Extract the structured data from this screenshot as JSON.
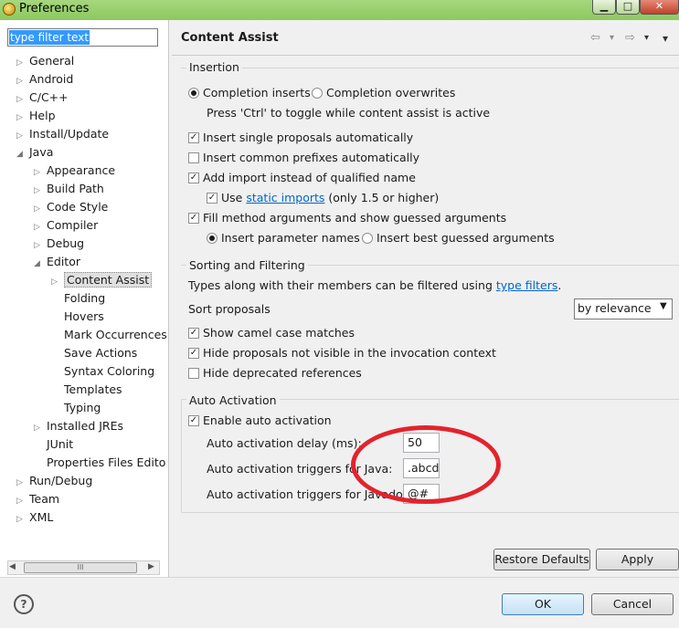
{
  "window": {
    "title": "Preferences",
    "min_glyph": "▁",
    "max_glyph": "□",
    "close_glyph": "✕"
  },
  "filter": {
    "value": "type filter text"
  },
  "tree": [
    {
      "label": "General",
      "arrow": "▷",
      "level": 0
    },
    {
      "label": "Android",
      "arrow": "▷",
      "level": 0
    },
    {
      "label": "C/C++",
      "arrow": "▷",
      "level": 0
    },
    {
      "label": "Help",
      "arrow": "▷",
      "level": 0
    },
    {
      "label": "Install/Update",
      "arrow": "▷",
      "level": 0
    },
    {
      "label": "Java",
      "arrow": "◢",
      "level": 0
    },
    {
      "label": "Appearance",
      "arrow": "▷",
      "level": 1
    },
    {
      "label": "Build Path",
      "arrow": "▷",
      "level": 1
    },
    {
      "label": "Code Style",
      "arrow": "▷",
      "level": 1
    },
    {
      "label": "Compiler",
      "arrow": "▷",
      "level": 1
    },
    {
      "label": "Debug",
      "arrow": "▷",
      "level": 1
    },
    {
      "label": "Editor",
      "arrow": "◢",
      "level": 1
    },
    {
      "label": "Content Assist",
      "arrow": "▷",
      "level": 2,
      "selected": true
    },
    {
      "label": "Folding",
      "arrow": "",
      "level": 2
    },
    {
      "label": "Hovers",
      "arrow": "",
      "level": 2
    },
    {
      "label": "Mark Occurrences",
      "arrow": "",
      "level": 2
    },
    {
      "label": "Save Actions",
      "arrow": "",
      "level": 2
    },
    {
      "label": "Syntax Coloring",
      "arrow": "",
      "level": 2
    },
    {
      "label": "Templates",
      "arrow": "",
      "level": 2
    },
    {
      "label": "Typing",
      "arrow": "",
      "level": 2
    },
    {
      "label": "Installed JREs",
      "arrow": "▷",
      "level": 1
    },
    {
      "label": "JUnit",
      "arrow": "",
      "level": 1
    },
    {
      "label": "Properties Files Edito",
      "arrow": "",
      "level": 1
    },
    {
      "label": "Run/Debug",
      "arrow": "▷",
      "level": 0
    },
    {
      "label": "Team",
      "arrow": "▷",
      "level": 0
    },
    {
      "label": "XML",
      "arrow": "▷",
      "level": 0
    }
  ],
  "scrollbar": {
    "left": "◀",
    "right": "▶",
    "thumb": "III"
  },
  "page": {
    "title": "Content Assist",
    "nav_back": "⇦",
    "nav_back_menu": "▾",
    "nav_forward": "⇨",
    "nav_forward_menu": "▾",
    "view_menu": "▾"
  },
  "insertion": {
    "legend": "Insertion",
    "radio_inserts": "Completion inserts",
    "radio_overwrites": "Completion overwrites",
    "hint": "Press 'Ctrl' to toggle while content assist is active",
    "single_proposals": "Insert single proposals automatically",
    "common_prefixes": "Insert common prefixes automatically",
    "add_import": "Add import instead of qualified name",
    "use_label": "Use",
    "static_imports_link": "static imports",
    "static_imports_note": "(only 1.5 or higher)",
    "fill_args": "Fill method arguments and show guessed arguments",
    "param_names": "Insert parameter names",
    "best_guessed": "Insert best guessed arguments"
  },
  "sorting": {
    "legend": "Sorting and Filtering",
    "desc": "Types along with their members can be filtered using",
    "type_filters_link": "type filters",
    "desc_end": ".",
    "sort_label": "Sort proposals",
    "sort_value": "by relevance",
    "camel_case": "Show camel case matches",
    "hide_not_visible": "Hide proposals not visible in the invocation context",
    "hide_deprecated": "Hide deprecated references"
  },
  "auto": {
    "legend": "Auto Activation",
    "enable": "Enable auto activation",
    "delay_label": "Auto activation delay (ms):",
    "delay_value": "50",
    "java_label": "Auto activation triggers for Java:",
    "java_value": ".abcd",
    "javadoc_label": "Auto activation triggers for Javadoc:",
    "javadoc_value": "@#"
  },
  "checks": {
    "on": "✓"
  },
  "buttons": {
    "restore": "Restore Defaults",
    "apply": "Apply",
    "ok": "OK",
    "cancel": "Cancel",
    "help": "?"
  }
}
